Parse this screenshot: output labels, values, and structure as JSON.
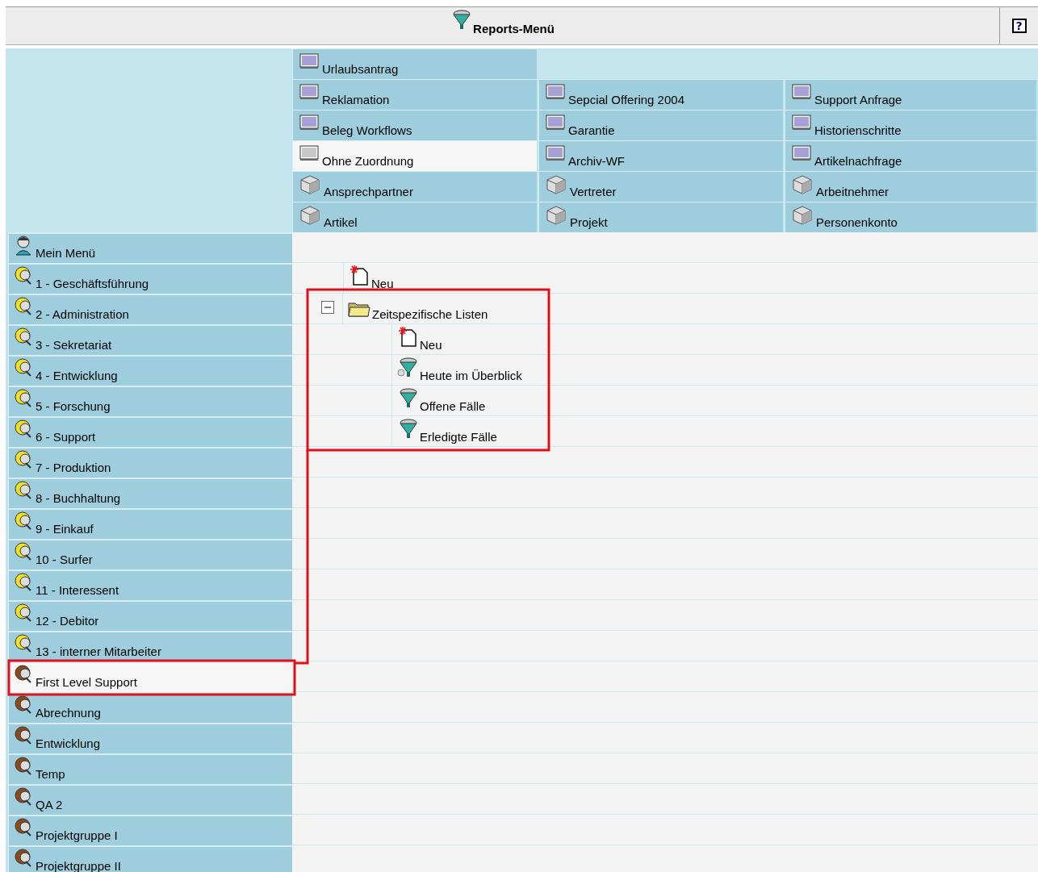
{
  "window": {
    "title": "Reports-Menü",
    "help_label": "?"
  },
  "tabs": [
    [
      {
        "label": "Urlaubsantrag",
        "kind": "form",
        "selected": false
      }
    ],
    [
      {
        "label": "Reklamation",
        "kind": "form",
        "selected": false
      },
      {
        "label": "Sepcial Offering 2004",
        "kind": "form",
        "selected": false
      },
      {
        "label": "Support Anfrage",
        "kind": "form",
        "selected": false
      }
    ],
    [
      {
        "label": "Beleg Workflows",
        "kind": "form",
        "selected": false
      },
      {
        "label": "Garantie",
        "kind": "form",
        "selected": false
      },
      {
        "label": "Historienschritte",
        "kind": "form",
        "selected": false
      }
    ],
    [
      {
        "label": "Ohne Zuordnung",
        "kind": "form",
        "selected": true
      },
      {
        "label": "Archiv-WF",
        "kind": "form",
        "selected": false
      },
      {
        "label": "Artikelnachfrage",
        "kind": "form",
        "selected": false
      }
    ],
    [
      {
        "label": "Ansprechpartner",
        "kind": "cube",
        "selected": false
      },
      {
        "label": "Vertreter",
        "kind": "cube",
        "selected": false
      },
      {
        "label": "Arbeitnehmer",
        "kind": "cube",
        "selected": false
      }
    ],
    [
      {
        "label": "Artikel",
        "kind": "cube",
        "selected": false
      },
      {
        "label": "Projekt",
        "kind": "cube",
        "selected": false
      },
      {
        "label": "Personenkonto",
        "kind": "cube",
        "selected": false
      }
    ]
  ],
  "sidebar": {
    "items": [
      {
        "label": "Mein Menü",
        "kind": "personal",
        "selected": false
      },
      {
        "label": "1 - Geschäftsführung",
        "kind": "group",
        "selected": false
      },
      {
        "label": "2 - Administration",
        "kind": "group",
        "selected": false
      },
      {
        "label": "3 - Sekretariat",
        "kind": "group",
        "selected": false
      },
      {
        "label": "4 - Entwicklung",
        "kind": "group",
        "selected": false
      },
      {
        "label": "5 - Forschung",
        "kind": "group",
        "selected": false
      },
      {
        "label": "6 - Support",
        "kind": "group",
        "selected": false
      },
      {
        "label": "7 - Produktion",
        "kind": "group",
        "selected": false
      },
      {
        "label": "8 - Buchhaltung",
        "kind": "group",
        "selected": false
      },
      {
        "label": "9 - Einkauf",
        "kind": "group",
        "selected": false
      },
      {
        "label": "10 - Surfer",
        "kind": "group",
        "selected": false
      },
      {
        "label": "11 - Interessent",
        "kind": "group",
        "selected": false
      },
      {
        "label": "12 - Debitor",
        "kind": "group",
        "selected": false
      },
      {
        "label": "13 - interner Mitarbeiter",
        "kind": "group",
        "selected": false
      },
      {
        "label": "First Level Support",
        "kind": "team",
        "selected": true
      },
      {
        "label": "Abrechnung",
        "kind": "team",
        "selected": false
      },
      {
        "label": "Entwicklung",
        "kind": "team",
        "selected": false
      },
      {
        "label": "Temp",
        "kind": "team",
        "selected": false
      },
      {
        "label": "QA 2",
        "kind": "team",
        "selected": false
      },
      {
        "label": "Projektgruppe I",
        "kind": "team",
        "selected": false
      },
      {
        "label": "Projektgruppe II",
        "kind": "team",
        "selected": false
      }
    ]
  },
  "tree": [
    {
      "label": "Neu",
      "kind": "new"
    },
    {
      "label": "Zeitspezifische Listen",
      "kind": "folder",
      "expanded": true,
      "children": [
        {
          "label": "Neu",
          "kind": "new"
        },
        {
          "label": "Heute im Überblick",
          "kind": "report-today"
        },
        {
          "label": "Offene Fälle",
          "kind": "report"
        },
        {
          "label": "Erledigte Fälle",
          "kind": "report"
        }
      ]
    }
  ]
}
